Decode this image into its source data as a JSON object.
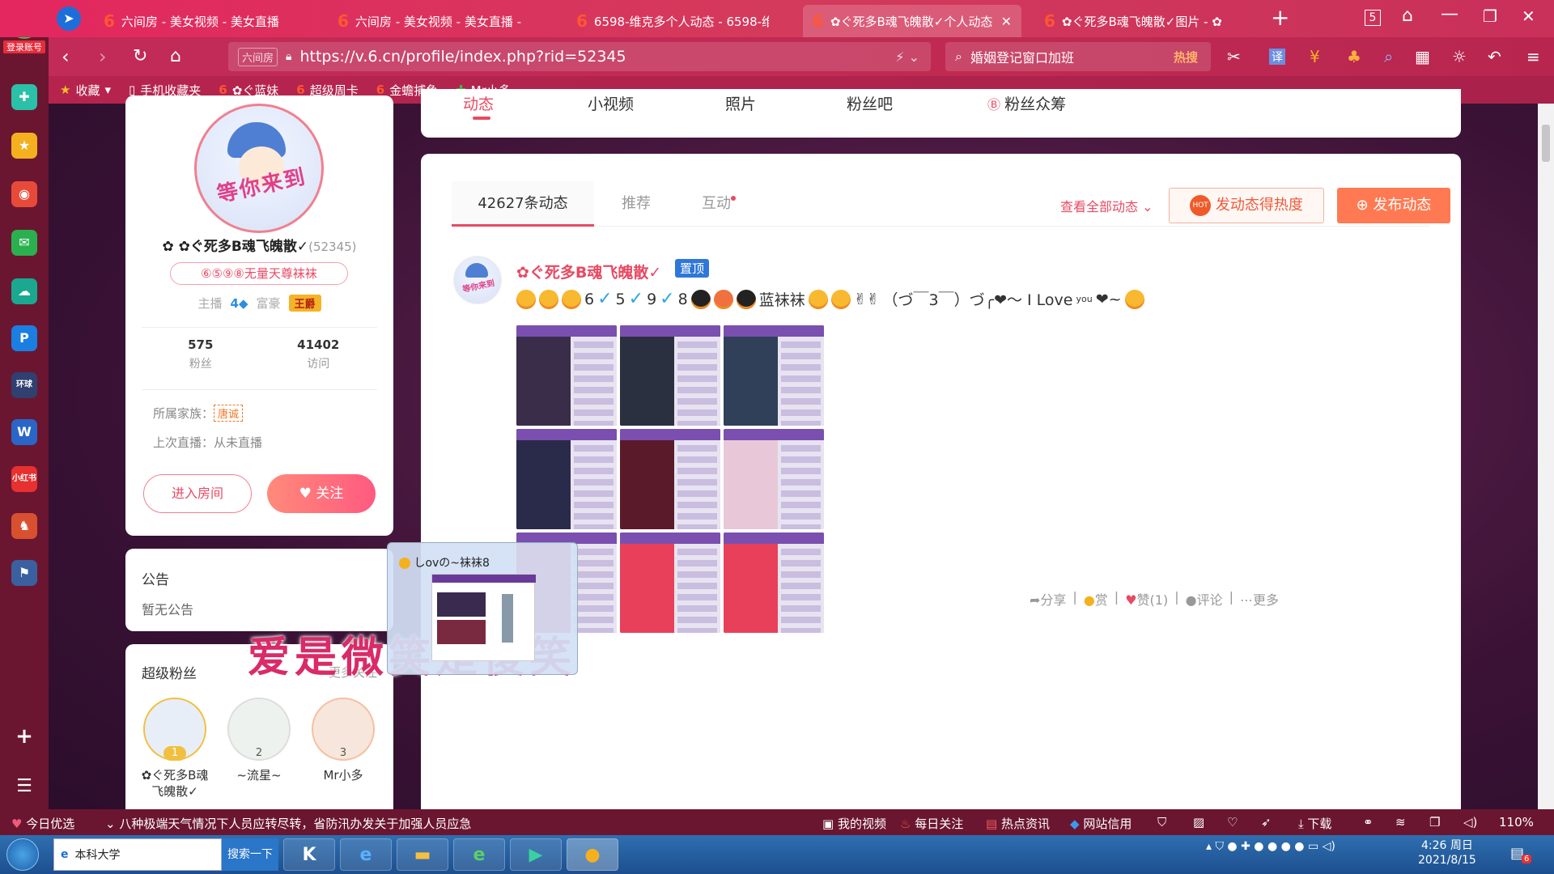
{
  "browser": {
    "side_logo_label": "登录账号",
    "tabs": [
      {
        "label": "六间房 - 美女视频 - 美女直播"
      },
      {
        "label": "六间房 - 美女视频 - 美女直播 -"
      },
      {
        "label": "6598-维克多个人动态 - 6598-维"
      },
      {
        "label": "✿ぐ死多B魂飞魄散✓个人动态"
      },
      {
        "label": "✿ぐ死多B魂飞魄散✓图片 - ✿"
      }
    ],
    "tab_count": "5",
    "url": "https://v.6.cn/profile/index.php?rid=52345",
    "url_badge": "六间房",
    "search_text": "婚姻登记窗口加班",
    "search_hot": "热搜",
    "bookmarks": [
      "收藏",
      "手机收藏夹",
      "✿ぐ蓝妹",
      "超级周卡",
      "金蟾捕鱼",
      "Mr小多"
    ]
  },
  "profile": {
    "avatar_text": "等你来到",
    "name": "✿ぐ死多B魂飞魄散✓",
    "rid": "(52345)",
    "title_badge": "⑥⑤⑨⑧无量天尊袜袜",
    "anchor_label": "主播",
    "anchor_level": "4",
    "rich_label": "富豪",
    "rich_badge": "王爵",
    "fans_count": "575",
    "fans_label": "粉丝",
    "visit_count": "41402",
    "visit_label": "访问",
    "family_label": "所属家族：",
    "family_badge": "唐诚",
    "last_live": "上次直播：从未直播",
    "enter_button": "进入房间",
    "follow_button": "关注"
  },
  "notice": {
    "title": "公告",
    "body": "暂无公告"
  },
  "superfans": {
    "title": "超级粉丝",
    "more": "更多关注",
    "items": [
      {
        "rank": "1",
        "name": "✿ぐ死多B魂飞魄散✓"
      },
      {
        "rank": "2",
        "name": "~流星~"
      },
      {
        "rank": "3",
        "name": "Mr小多"
      }
    ]
  },
  "top_tabs": [
    "动态",
    "小视频",
    "照片",
    "粉丝吧",
    "粉丝众筹"
  ],
  "feed": {
    "tabs": [
      "42627条动态",
      "推荐",
      "互动"
    ],
    "view_all": "查看全部动态",
    "hot_button": "发动态得热度",
    "post_button": "发布动态",
    "post": {
      "author": "✿ぐ死多B魂飞魄散✓",
      "pin": "置顶",
      "digits": [
        "6",
        "5",
        "9",
        "8"
      ],
      "text_name": "蓝袜袜",
      "text_tail": "（づ￣3￣）づ╭❤～ I Love",
      "text_sub": "you",
      "text_end": "❤~",
      "image_count": 9,
      "actions": {
        "share": "分享",
        "reward": "赏",
        "like": "赞(1)",
        "comment": "评论",
        "more": "更多"
      }
    }
  },
  "preview": {
    "title": "しovの~袜袜8"
  },
  "overlay_text": "爱是微笑是傻笑",
  "newsbar": {
    "today": "今日优选",
    "headline": "八种极端天气情况下人员应转尽转，省防汛办发关于加强人员应急",
    "items": [
      "我的视频",
      "每日关注",
      "热点资讯",
      "网站信用",
      "下载"
    ],
    "zoom": "110%"
  },
  "taskbar": {
    "ie_label": "本科大学",
    "search_btn": "搜索一下",
    "time": "4:26 周日",
    "date": "2021/8/15",
    "notif": "6"
  },
  "colors": {
    "accent": "#e84a63",
    "chrome": "#d43a5c",
    "post_btn": "#ff7a52",
    "pin": "#2f77d8"
  }
}
